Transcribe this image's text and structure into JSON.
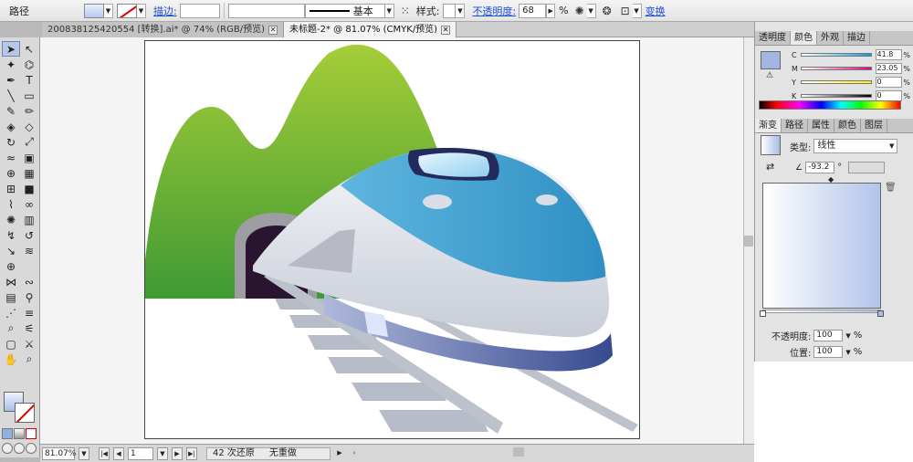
{
  "control_bar": {
    "object_type": "路径",
    "stroke_label": "描边:",
    "stroke_style": "基本",
    "style_label": "样式:",
    "opacity_label": "不透明度:",
    "opacity_value": "68",
    "percent": "%",
    "transform_label": "变换"
  },
  "tabs": [
    {
      "title": "200838125420554 [转换].ai* @ 74% (RGB/预览)",
      "active": false
    },
    {
      "title": "未标题-2* @ 81.07% (CMYK/预览)",
      "active": true
    }
  ],
  "status_bar": {
    "zoom": "81.07%",
    "artboard_number": "1",
    "history": "42 次还原",
    "redo": "无重做"
  },
  "color_panel": {
    "tabs": [
      "透明度",
      "颜色",
      "外观",
      "描边"
    ],
    "active_tab": "颜色",
    "channels": [
      {
        "label": "C",
        "value": "41.8",
        "grad": [
          "#ffffff",
          "#00a0e9"
        ]
      },
      {
        "label": "M",
        "value": "23.05",
        "grad": [
          "#ffffff",
          "#e4007f"
        ]
      },
      {
        "label": "Y",
        "value": "0",
        "grad": [
          "#ffffff",
          "#fff100"
        ]
      },
      {
        "label": "K",
        "value": "0",
        "grad": [
          "#ffffff",
          "#000000"
        ]
      }
    ],
    "percent": "%",
    "swatch_color": "#a3b6e3"
  },
  "gradient_panel": {
    "tabs": [
      "渐变",
      "路径",
      "属性",
      "颜色",
      "图层"
    ],
    "active_tab": "渐变",
    "type_label": "类型:",
    "type_value": "线性",
    "angle_value": "-93.2",
    "degree": "°",
    "opacity_label": "不透明度:",
    "opacity_value": "100",
    "position_label": "位置:",
    "position_value": "100",
    "percent": "%"
  },
  "tools": [
    {
      "name": "selection-tool",
      "glyph": "➤",
      "selected": true
    },
    {
      "name": "direct-selection-tool",
      "glyph": "↖",
      "selected": false
    },
    {
      "name": "magic-wand-tool",
      "glyph": "✦",
      "selected": false
    },
    {
      "name": "lasso-tool",
      "glyph": "⌬",
      "selected": false
    },
    {
      "name": "pen-tool",
      "glyph": "✒",
      "selected": false
    },
    {
      "name": "type-tool",
      "glyph": "T",
      "selected": false
    },
    {
      "name": "line-tool",
      "glyph": "╲",
      "selected": false
    },
    {
      "name": "rectangle-tool",
      "glyph": "▭",
      "selected": false
    },
    {
      "name": "paintbrush-tool",
      "glyph": "✎",
      "selected": false
    },
    {
      "name": "pencil-tool",
      "glyph": "✏",
      "selected": false
    },
    {
      "name": "blob-brush-tool",
      "glyph": "◈",
      "selected": false
    },
    {
      "name": "eraser-tool",
      "glyph": "◇",
      "selected": false
    },
    {
      "name": "rotate-tool",
      "glyph": "↻",
      "selected": false
    },
    {
      "name": "scale-tool",
      "glyph": "⤢",
      "selected": false
    },
    {
      "name": "warp-tool",
      "glyph": "≈",
      "selected": false
    },
    {
      "name": "free-transform-tool",
      "glyph": "▣",
      "selected": false
    },
    {
      "name": "shape-builder-tool",
      "glyph": "⊕",
      "selected": false
    },
    {
      "name": "perspective-grid-tool",
      "glyph": "▦",
      "selected": false
    },
    {
      "name": "mesh-tool",
      "glyph": "⊞",
      "selected": false
    },
    {
      "name": "gradient-tool",
      "glyph": "■",
      "selected": false
    },
    {
      "name": "eyedropper-tool",
      "glyph": "⌇",
      "selected": false
    },
    {
      "name": "blend-tool",
      "glyph": "∞",
      "selected": false
    },
    {
      "name": "symbol-sprayer-tool",
      "glyph": "✺",
      "selected": false
    },
    {
      "name": "column-graph-tool",
      "glyph": "▥",
      "selected": false
    },
    {
      "name": "artboard-tool",
      "glyph": "↯",
      "selected": false
    },
    {
      "name": "slice-tool",
      "glyph": "↺",
      "selected": false
    },
    {
      "name": "eraser-red-tool",
      "glyph": "↘",
      "selected": false
    },
    {
      "name": "scissors-tool",
      "glyph": "≋",
      "selected": false
    },
    {
      "name": "crosshair-tool",
      "glyph": "⊕",
      "selected": false
    },
    {
      "name": "spacer",
      "glyph": "",
      "selected": false
    },
    {
      "name": "envelope-tool",
      "glyph": "⋈",
      "selected": false
    },
    {
      "name": "twirl-tool",
      "glyph": "∾",
      "selected": false
    },
    {
      "name": "graph-tool",
      "glyph": "▤",
      "selected": false
    },
    {
      "name": "puppet-tool",
      "glyph": "⚲",
      "selected": false
    },
    {
      "name": "knife-tool",
      "glyph": "⋰",
      "selected": false
    },
    {
      "name": "list-tool",
      "glyph": "≡",
      "selected": false
    },
    {
      "name": "eyedropper-alt-tool",
      "glyph": "⌕",
      "selected": false
    },
    {
      "name": "measure-tool",
      "glyph": "⚟",
      "selected": false
    },
    {
      "name": "crop-tool",
      "glyph": "▢",
      "selected": false
    },
    {
      "name": "knife-alt-tool",
      "glyph": "⚔",
      "selected": false
    },
    {
      "name": "hand-tool",
      "glyph": "✋",
      "selected": false
    },
    {
      "name": "zoom-tool",
      "glyph": "⌕",
      "selected": false
    }
  ]
}
